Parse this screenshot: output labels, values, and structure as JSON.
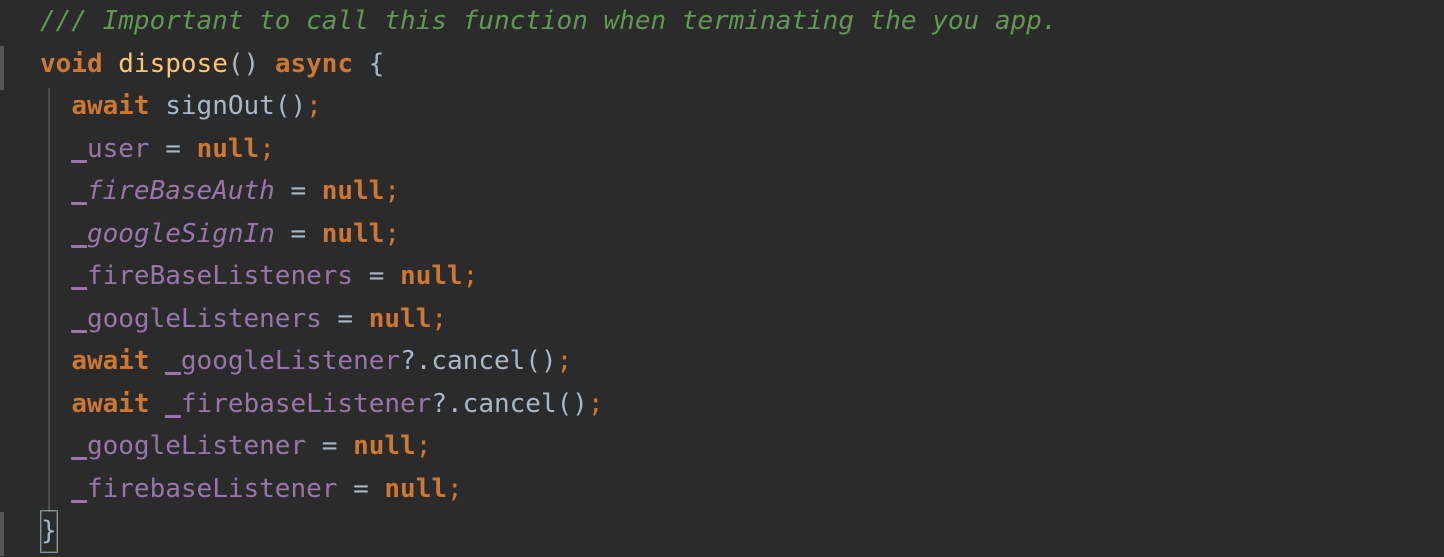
{
  "editor": {
    "theme": "darcula",
    "background_color": "#2b2b2b",
    "default_text_color": "#a9b7c6",
    "language": "dart",
    "font_size_px": 26,
    "line_height_px": 42.5
  },
  "colors": {
    "comment": "#629755",
    "keyword": "#cc7832",
    "method_declaration": "#ffc66d",
    "field": "#9876aa",
    "default": "#a9b7c6",
    "semicolon": "#cc7832",
    "indent_guide": "#4b4b4b",
    "gutter_marker": "#606060"
  },
  "code_lines": [
    {
      "index": 0,
      "indent": "",
      "raw": "/// Important to call this function when terminating the you app.",
      "tokens": [
        {
          "text": "/// Important to call this function when terminating the you app.",
          "type": "comment"
        }
      ]
    },
    {
      "index": 1,
      "indent": "",
      "raw": "void dispose() async {",
      "tokens": [
        {
          "text": "void",
          "type": "keyword"
        },
        {
          "text": " ",
          "type": "plain"
        },
        {
          "text": "dispose",
          "type": "method"
        },
        {
          "text": "()",
          "type": "punct"
        },
        {
          "text": " ",
          "type": "plain"
        },
        {
          "text": "async",
          "type": "keyword"
        },
        {
          "text": " ",
          "type": "plain"
        },
        {
          "text": "{",
          "type": "brace"
        }
      ]
    },
    {
      "index": 2,
      "indent": "  ",
      "raw": "  await signOut();",
      "tokens": [
        {
          "text": "await",
          "type": "keyword"
        },
        {
          "text": " ",
          "type": "plain"
        },
        {
          "text": "signOut",
          "type": "call"
        },
        {
          "text": "()",
          "type": "punct"
        },
        {
          "text": ";",
          "type": "semi"
        }
      ]
    },
    {
      "index": 3,
      "indent": "  ",
      "raw": "  _user = null;",
      "tokens": [
        {
          "text": "_user",
          "type": "field",
          "underline": true
        },
        {
          "text": " ",
          "type": "plain"
        },
        {
          "text": "=",
          "type": "op"
        },
        {
          "text": " ",
          "type": "plain"
        },
        {
          "text": "null",
          "type": "keyword"
        },
        {
          "text": ";",
          "type": "semi"
        }
      ]
    },
    {
      "index": 4,
      "indent": "  ",
      "raw": "  _fireBaseAuth = null;",
      "tokens": [
        {
          "text": "_fireBaseAuth",
          "type": "field-italic",
          "underline": true
        },
        {
          "text": " ",
          "type": "plain"
        },
        {
          "text": "=",
          "type": "op"
        },
        {
          "text": " ",
          "type": "plain"
        },
        {
          "text": "null",
          "type": "keyword"
        },
        {
          "text": ";",
          "type": "semi"
        }
      ]
    },
    {
      "index": 5,
      "indent": "  ",
      "raw": "  _googleSignIn = null;",
      "tokens": [
        {
          "text": "_googleSignIn",
          "type": "field-italic",
          "underline": true
        },
        {
          "text": " ",
          "type": "plain"
        },
        {
          "text": "=",
          "type": "op"
        },
        {
          "text": " ",
          "type": "plain"
        },
        {
          "text": "null",
          "type": "keyword"
        },
        {
          "text": ";",
          "type": "semi"
        }
      ]
    },
    {
      "index": 6,
      "indent": "  ",
      "raw": "  _fireBaseListeners = null;",
      "tokens": [
        {
          "text": "_fireBaseListeners",
          "type": "field",
          "underline": true
        },
        {
          "text": " ",
          "type": "plain"
        },
        {
          "text": "=",
          "type": "op"
        },
        {
          "text": " ",
          "type": "plain"
        },
        {
          "text": "null",
          "type": "keyword"
        },
        {
          "text": ";",
          "type": "semi"
        }
      ]
    },
    {
      "index": 7,
      "indent": "  ",
      "raw": "  _googleListeners = null;",
      "tokens": [
        {
          "text": "_googleListeners",
          "type": "field",
          "underline": true
        },
        {
          "text": " ",
          "type": "plain"
        },
        {
          "text": "=",
          "type": "op"
        },
        {
          "text": " ",
          "type": "plain"
        },
        {
          "text": "null",
          "type": "keyword"
        },
        {
          "text": ";",
          "type": "semi"
        }
      ]
    },
    {
      "index": 8,
      "indent": "  ",
      "raw": "  await _googleListener?.cancel();",
      "tokens": [
        {
          "text": "await",
          "type": "keyword"
        },
        {
          "text": " ",
          "type": "plain"
        },
        {
          "text": "_googleListener",
          "type": "field",
          "underline": true
        },
        {
          "text": "?.",
          "type": "punct"
        },
        {
          "text": "cancel",
          "type": "call"
        },
        {
          "text": "()",
          "type": "punct"
        },
        {
          "text": ";",
          "type": "semi"
        }
      ]
    },
    {
      "index": 9,
      "indent": "  ",
      "raw": "  await _firebaseListener?.cancel();",
      "tokens": [
        {
          "text": "await",
          "type": "keyword"
        },
        {
          "text": " ",
          "type": "plain"
        },
        {
          "text": "_firebaseListener",
          "type": "field",
          "underline": true
        },
        {
          "text": "?.",
          "type": "punct"
        },
        {
          "text": "cancel",
          "type": "call"
        },
        {
          "text": "()",
          "type": "punct"
        },
        {
          "text": ";",
          "type": "semi"
        }
      ]
    },
    {
      "index": 10,
      "indent": "  ",
      "raw": "  _googleListener = null;",
      "tokens": [
        {
          "text": "_googleListener",
          "type": "field",
          "underline": true
        },
        {
          "text": " ",
          "type": "plain"
        },
        {
          "text": "=",
          "type": "op"
        },
        {
          "text": " ",
          "type": "plain"
        },
        {
          "text": "null",
          "type": "keyword"
        },
        {
          "text": ";",
          "type": "semi"
        }
      ]
    },
    {
      "index": 11,
      "indent": "  ",
      "raw": "  _firebaseListener = null;",
      "tokens": [
        {
          "text": "_firebaseListener",
          "type": "field",
          "underline": true
        },
        {
          "text": " ",
          "type": "plain"
        },
        {
          "text": "=",
          "type": "op"
        },
        {
          "text": " ",
          "type": "plain"
        },
        {
          "text": "null",
          "type": "keyword"
        },
        {
          "text": ";",
          "type": "semi"
        }
      ]
    },
    {
      "index": 12,
      "indent": "",
      "raw": "}",
      "brace_match": true,
      "tokens": [
        {
          "text": "}",
          "type": "brace",
          "matched": true
        }
      ]
    }
  ]
}
